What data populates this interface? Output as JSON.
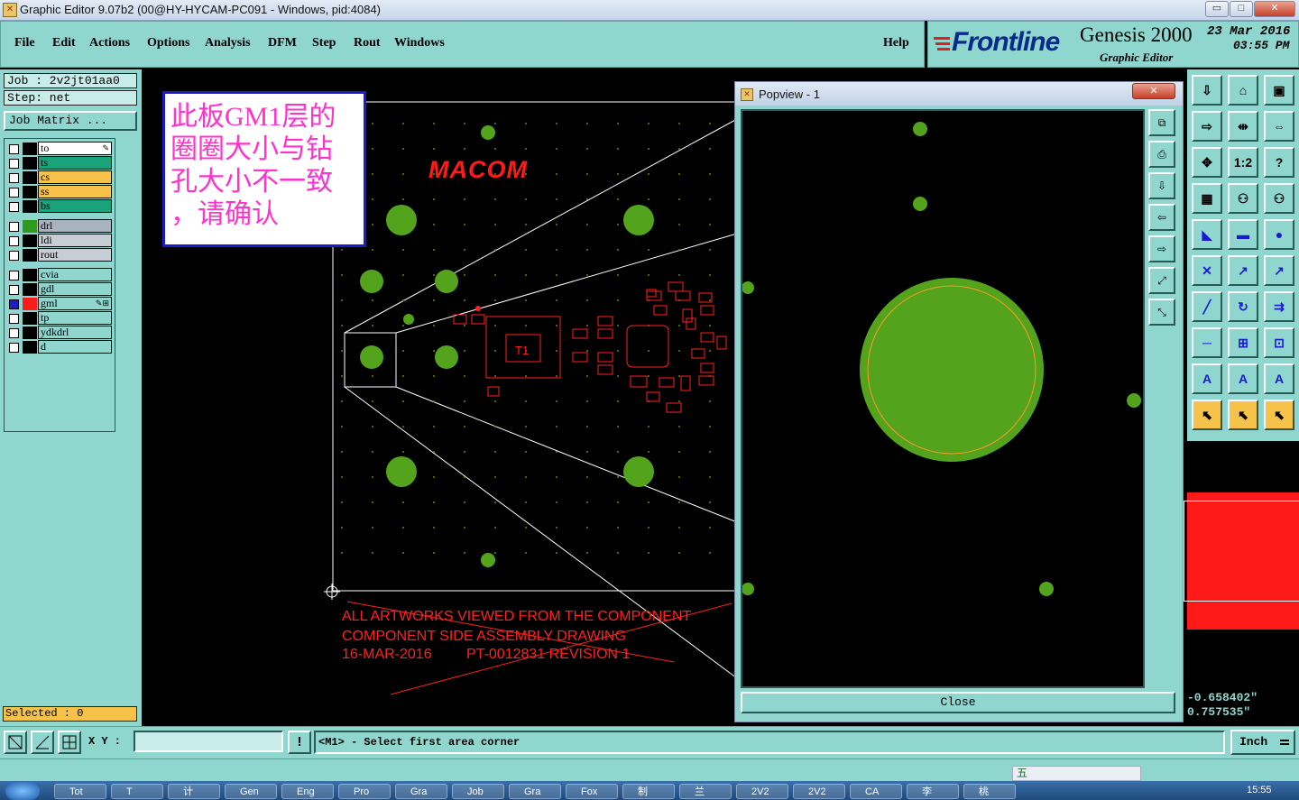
{
  "window": {
    "title": "Graphic Editor 9.07b2 (00@HY-HYCAM-PC091 - Windows, pid:4084)",
    "min_glyph": "▭",
    "max_glyph": "□",
    "close_glyph": "✕"
  },
  "menubar": {
    "items": [
      "File",
      "Edit",
      "Actions",
      "Options",
      "Analysis",
      "DFM",
      "Step",
      "Rout",
      "Windows"
    ],
    "help": "Help"
  },
  "brand": {
    "logo": "Frontline",
    "product": "Genesis 2000",
    "subtitle": "Graphic Editor",
    "date": "23 Mar 2016",
    "time": "03:55 PM"
  },
  "job": {
    "job_label": "Job : 2v2jt01aa0",
    "step_label": "Step: net",
    "matrix_button": "Job Matrix ..."
  },
  "layers": {
    "group1": [
      {
        "name": "to",
        "color": "#ffffff",
        "mark": "✎"
      },
      {
        "name": "ts",
        "color": "#1aa37a"
      },
      {
        "name": "cs",
        "color": "#f6c24a"
      },
      {
        "name": "ss",
        "color": "#f6c24a"
      },
      {
        "name": "bs",
        "color": "#1aa37a"
      }
    ],
    "group2": [
      {
        "name": "drl",
        "color": "#a9b3bf",
        "swatch": "#2f9a20"
      },
      {
        "name": "ldi",
        "color": "#c7cdd4"
      },
      {
        "name": "rout",
        "color": "#c7cdd4"
      }
    ],
    "group3": [
      {
        "name": "cvia",
        "color": "#8fd6cf"
      },
      {
        "name": "gdl",
        "color": "#8fd6cf"
      },
      {
        "name": "gml",
        "color": "#8fd6cf",
        "swatch": "#ff1a1a",
        "mark": "✎⊞",
        "active": true
      },
      {
        "name": "tp",
        "color": "#8fd6cf"
      },
      {
        "name": "ydkdrl",
        "color": "#8fd6cf"
      },
      {
        "name": "d",
        "color": "#8fd6cf"
      }
    ]
  },
  "selected": "Selected : 0",
  "note": {
    "text_lines": [
      "此板GM1层的",
      "圈圈大小与钻",
      "孔大小不一致",
      "，请确认"
    ]
  },
  "board": {
    "brand_text": "MACOM",
    "footer_lines": [
      "ALL ARTWORKS VIEWED FROM THE COMPONENT",
      "COMPONENT SIDE ASSEMBLY DRAWING",
      "16-MAR-2016",
      "PT-0012831  REVISION 1"
    ],
    "part_label": "T1"
  },
  "popview": {
    "title": "Popview - 1",
    "close_button": "Close"
  },
  "coords": {
    "x": "-0.658402\"",
    "y": "0.757535\""
  },
  "statusbar": {
    "xy_label": "X Y :",
    "xy_value": "",
    "warning_glyph": "!",
    "message": "<M1> - Select first area corner",
    "units": "Inch"
  },
  "taskbar": {
    "items": [
      "Tot",
      "T",
      "计",
      "Gen",
      "Eng",
      "Pro",
      "Gra",
      "Job",
      "Gra",
      "Fox",
      "制",
      "兰",
      "2V2",
      "2V2",
      "CA",
      "李",
      "桃"
    ],
    "clock": "15:55",
    "ime": "五"
  },
  "colors": {
    "panel": "#8fd6cf",
    "pad_green": "#54a31d",
    "red": "#ff1a1a"
  },
  "icons": {
    "toolbar_left": [
      "zoom-area-icon",
      "measure-icon",
      "snap-icon"
    ],
    "right_tools": [
      "load-icon",
      "home-icon",
      "layout-icon",
      "export-icon",
      "fit-icon",
      "split-icon",
      "pan-icon",
      "scale-icon",
      "help-icon",
      "grid-icon",
      "net-icon",
      "net-red-icon"
    ]
  }
}
